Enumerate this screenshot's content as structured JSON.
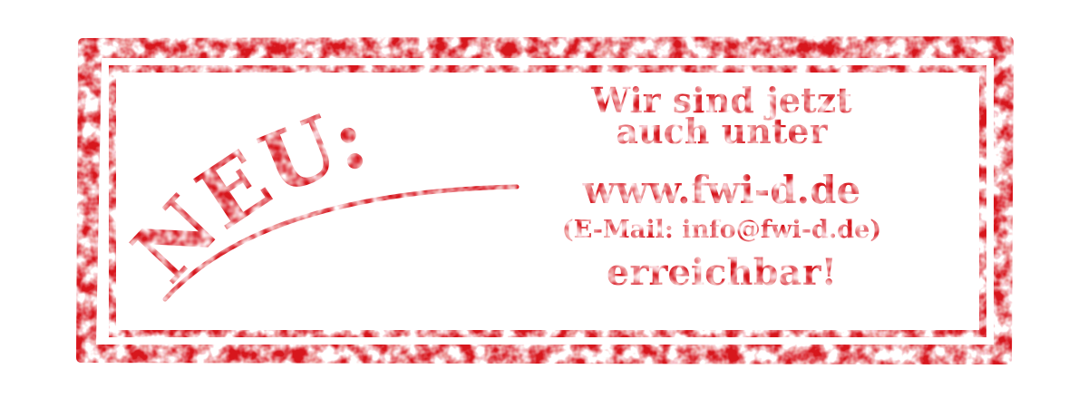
{
  "stamp": {
    "color": "#d7141c",
    "background": "#ffffff",
    "headline": "NEU:",
    "message": {
      "line1": "Wir sind jetzt",
      "line2": "auch unter",
      "url": "www.fwi-d.de",
      "email": "(E-Mail: info@fwi-d.de)",
      "closing": "erreichbar!"
    }
  }
}
